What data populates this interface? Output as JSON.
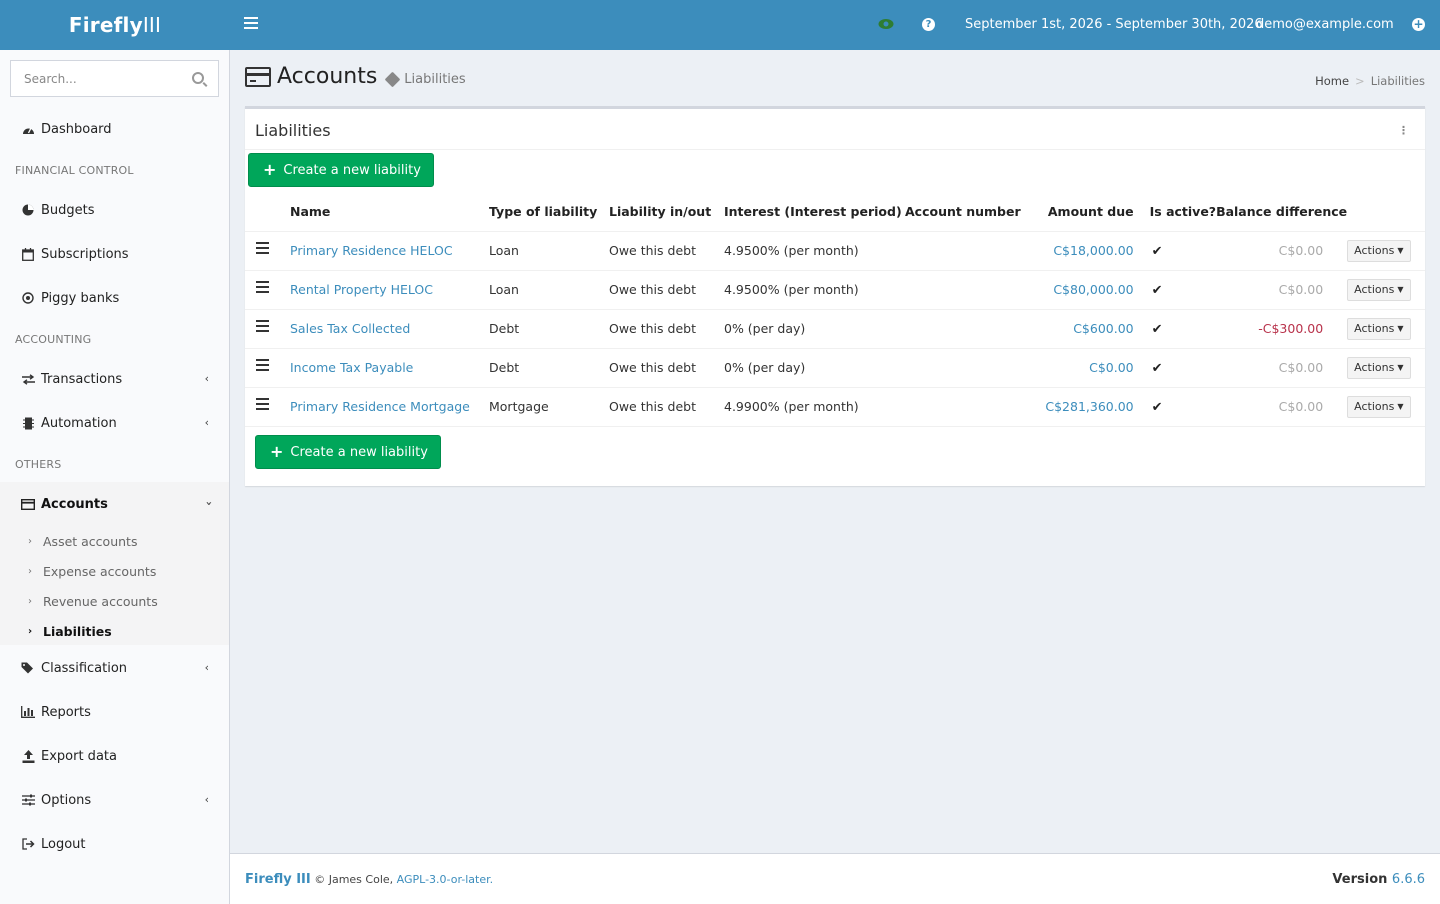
{
  "app": {
    "logo_bold": "Firefly",
    "logo_light": "III"
  },
  "topbar": {
    "date_range": "September 1st, 2026 - September 30th, 2026",
    "user_email": "demo@example.com"
  },
  "sidebar": {
    "search_placeholder": "Search...",
    "dashboard": "Dashboard",
    "header_financial": "FINANCIAL CONTROL",
    "budgets": "Budgets",
    "subscriptions": "Subscriptions",
    "piggy_banks": "Piggy banks",
    "header_accounting": "ACCOUNTING",
    "transactions": "Transactions",
    "automation": "Automation",
    "header_others": "OTHERS",
    "accounts": "Accounts",
    "asset_accounts": "Asset accounts",
    "expense_accounts": "Expense accounts",
    "revenue_accounts": "Revenue accounts",
    "liabilities": "Liabilities",
    "classification": "Classification",
    "reports": "Reports",
    "export_data": "Export data",
    "options": "Options",
    "logout": "Logout"
  },
  "page": {
    "title": "Accounts",
    "subtitle": "Liabilities",
    "breadcrumb_home": "Home",
    "breadcrumb_current": "Liabilities"
  },
  "box": {
    "title": "Liabilities",
    "create_label": "Create a new liability"
  },
  "table": {
    "headers": {
      "name": "Name",
      "type": "Type of liability",
      "inout": "Liability in/out",
      "interest": "Interest (Interest period)",
      "account_number": "Account number",
      "amount_due": "Amount due",
      "is_active": "Is active?",
      "balance_diff": "Balance difference"
    },
    "actions_label": "Actions",
    "rows": [
      {
        "name": "Primary Residence HELOC",
        "type": "Loan",
        "inout": "Owe this debt",
        "interest": "4.9500% (per month)",
        "account_number": "",
        "amount_due": "C$18,000.00",
        "balance_diff": "C$0.00"
      },
      {
        "name": "Rental Property HELOC",
        "type": "Loan",
        "inout": "Owe this debt",
        "interest": "4.9500% (per month)",
        "account_number": "",
        "amount_due": "C$80,000.00",
        "balance_diff": "C$0.00"
      },
      {
        "name": "Sales Tax Collected",
        "type": "Debt",
        "inout": "Owe this debt",
        "interest": "0% (per day)",
        "account_number": "",
        "amount_due": "C$600.00",
        "balance_diff": "-C$300.00"
      },
      {
        "name": "Income Tax Payable",
        "type": "Debt",
        "inout": "Owe this debt",
        "interest": "0% (per day)",
        "account_number": "",
        "amount_due": "C$0.00",
        "balance_diff": "C$0.00"
      },
      {
        "name": "Primary Residence Mortgage",
        "type": "Mortgage",
        "inout": "Owe this debt",
        "interest": "4.9900% (per month)",
        "account_number": "",
        "amount_due": "C$281,360.00",
        "balance_diff": "C$0.00"
      }
    ]
  },
  "footer": {
    "brand": "Firefly III",
    "copyright": "© James Cole,",
    "license": "AGPL-3.0-or-later.",
    "version_label": "Version",
    "version": "6.6.6"
  },
  "colors": {
    "header_blue": "#3c8dbc",
    "create_green": "#00a65a",
    "negative_red": "#b8324b"
  }
}
